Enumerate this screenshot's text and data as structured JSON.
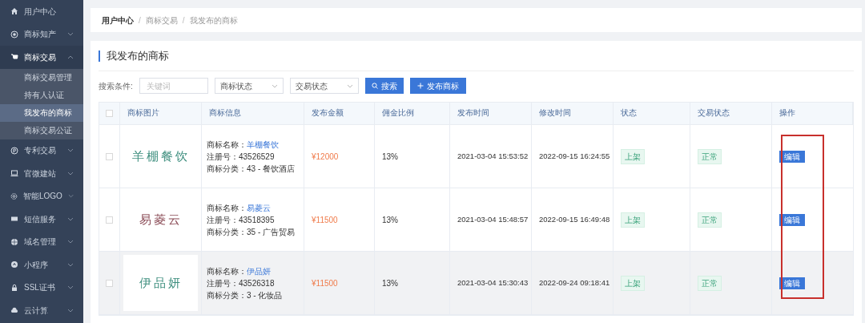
{
  "sidebar": {
    "items": [
      {
        "label": "用户中心"
      },
      {
        "label": "商标知产",
        "expanded": false
      },
      {
        "label": "商标交易",
        "expanded": true,
        "children": [
          {
            "label": "商标交易管理",
            "selected": false
          },
          {
            "label": "持有人认证",
            "selected": false
          },
          {
            "label": "我发布的商标",
            "selected": true
          },
          {
            "label": "商标交易公证",
            "selected": false
          }
        ]
      },
      {
        "label": "专利交易",
        "expanded": false
      },
      {
        "label": "官微建站",
        "expanded": false
      },
      {
        "label": "智能LOGO",
        "expanded": false
      },
      {
        "label": "短信服务",
        "expanded": false
      },
      {
        "label": "域名管理",
        "expanded": false
      },
      {
        "label": "小程序",
        "expanded": false
      },
      {
        "label": "SSL证书",
        "expanded": false
      },
      {
        "label": "云计算",
        "expanded": false
      }
    ]
  },
  "breadcrumb": [
    {
      "label": "用户中心"
    },
    {
      "separator": "/",
      "label": "商标交易"
    },
    {
      "separator": "/",
      "label": "我发布的商标"
    }
  ],
  "page_title": "我发布的商标",
  "filters": {
    "label": "搜索条件:",
    "keyword": {
      "placeholder": "关键词"
    },
    "selects": [
      "商标状态",
      "交易状态"
    ],
    "search_button": "搜索",
    "publish_button": "发布商标"
  },
  "table": {
    "all_checked": false,
    "columns": [
      "商标图片",
      "商标信息",
      "发布金额",
      "佣金比例",
      "发布时间",
      "修改时间",
      "状态",
      "交易状态",
      "操作"
    ],
    "rows": [
      {
        "checked": false,
        "highlighted": false,
        "logo_text": "羊棚餐饮",
        "name_label": "商标名称：",
        "name": "羊棚餐饮",
        "reg": "注册号：43526529",
        "category": "商标分类：43 - 餐饮酒店",
        "amount": "¥12000",
        "ratio": "13%",
        "published": "2021-03-04 15:53:52",
        "modified": "2022-09-15 16:24:55",
        "status": "上架",
        "trade_status": "正常",
        "action": "编辑"
      },
      {
        "checked": false,
        "highlighted": false,
        "logo_text": "易菱云",
        "name_label": "商标名称：",
        "name": "易菱云",
        "reg": "注册号：43518395",
        "category": "商标分类：35 - 广告贸易",
        "amount": "¥11500",
        "ratio": "13%",
        "published": "2021-03-04 15:48:57",
        "modified": "2022-09-15 16:49:48",
        "status": "上架",
        "trade_status": "正常",
        "action": "编辑"
      },
      {
        "checked": false,
        "highlighted": true,
        "logo_text": "伊品妍",
        "name_label": "商标名称：",
        "name": "伊品妍",
        "reg": "注册号：43526318",
        "category": "商标分类：3 - 化妆品",
        "amount": "¥11500",
        "ratio": "13%",
        "published": "2021-03-04 15:30:43",
        "modified": "2022-09-24 09:18:41",
        "status": "上架",
        "trade_status": "正常",
        "action": "编辑"
      }
    ]
  }
}
